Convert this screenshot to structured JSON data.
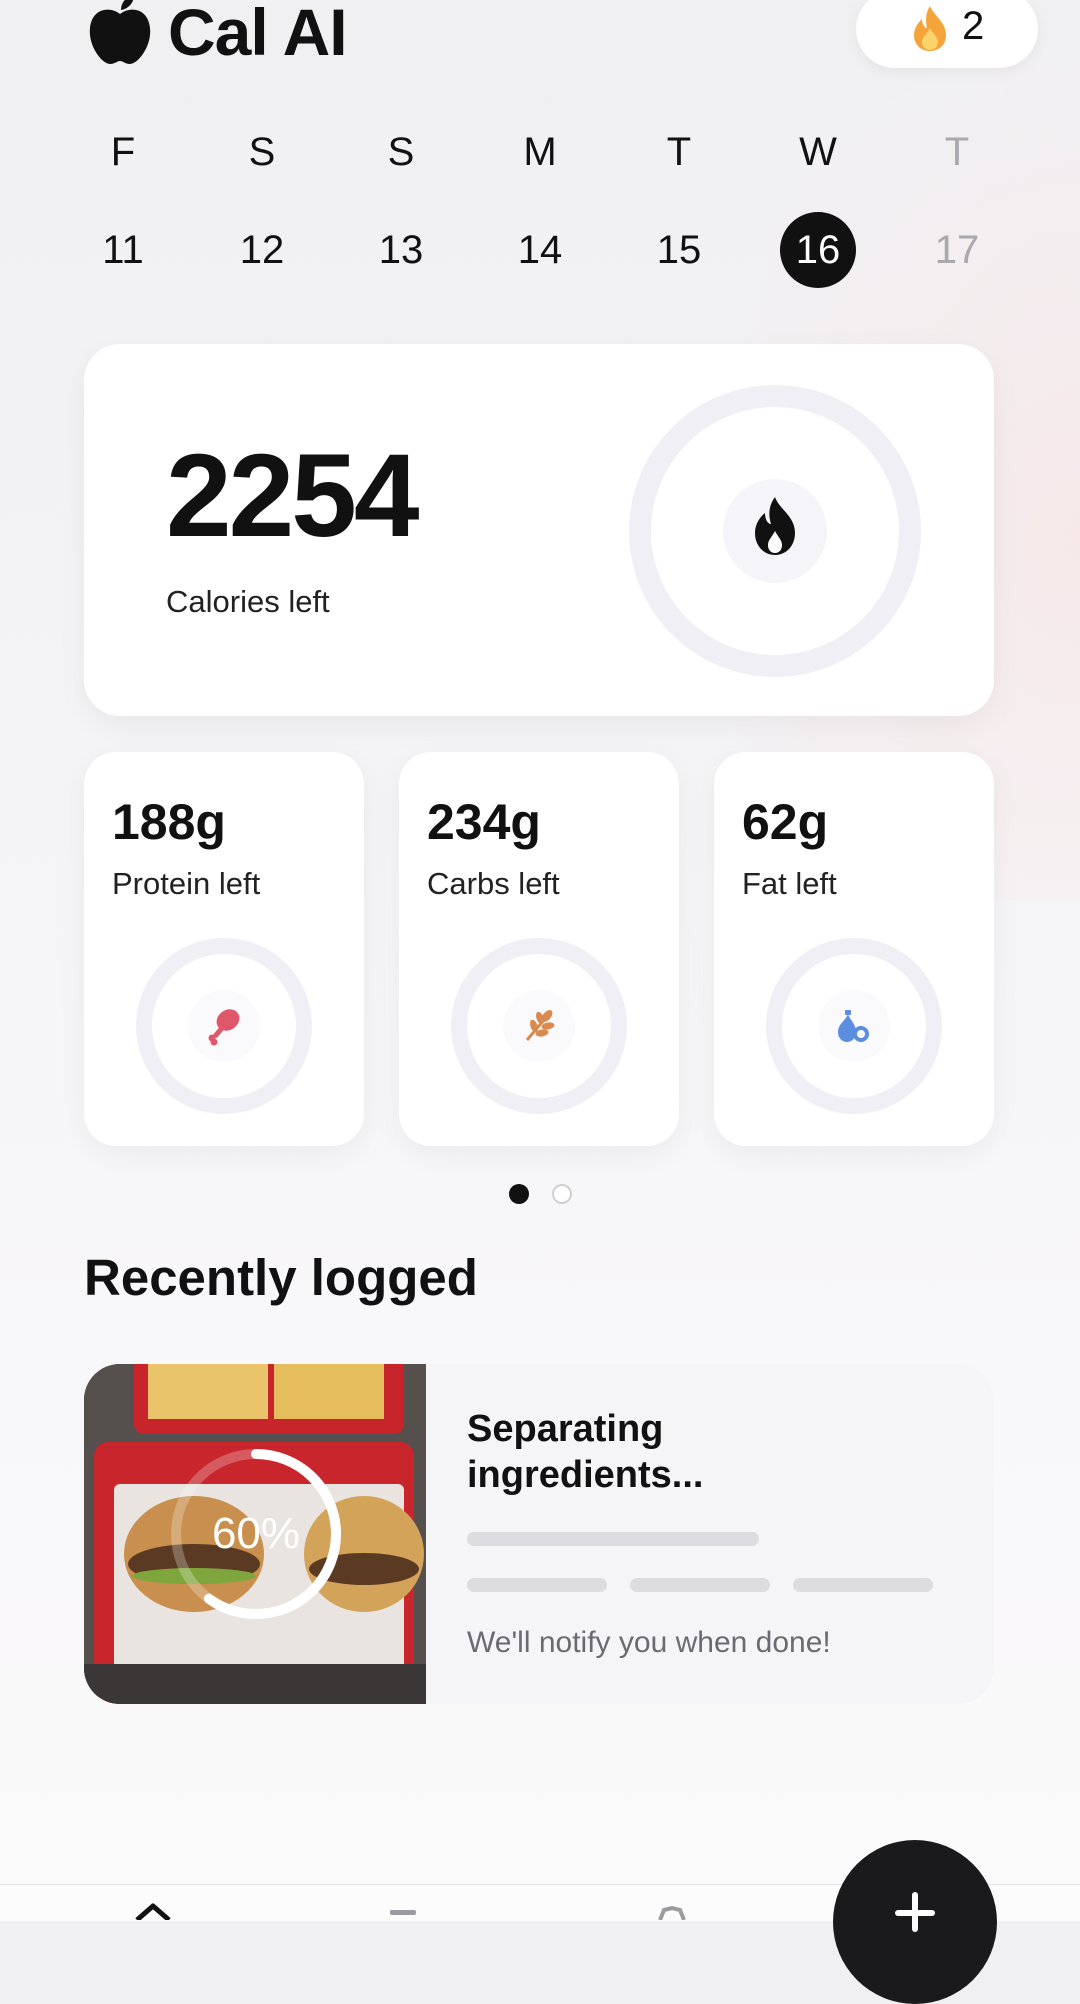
{
  "header": {
    "app_title": "Cal AI",
    "streak_count": "2",
    "logo_icon": "apple-icon",
    "streak_icon": "flame-icon"
  },
  "week": {
    "days": [
      {
        "letter": "F",
        "date": "11",
        "state": "normal"
      },
      {
        "letter": "S",
        "date": "12",
        "state": "normal"
      },
      {
        "letter": "S",
        "date": "13",
        "state": "normal"
      },
      {
        "letter": "M",
        "date": "14",
        "state": "normal"
      },
      {
        "letter": "T",
        "date": "15",
        "state": "normal"
      },
      {
        "letter": "W",
        "date": "16",
        "state": "selected"
      },
      {
        "letter": "T",
        "date": "17",
        "state": "future"
      }
    ]
  },
  "calories": {
    "value": "2254",
    "label": "Calories left",
    "icon": "flame-icon"
  },
  "macros": [
    {
      "value": "188g",
      "label": "Protein left",
      "icon": "drumstick-icon",
      "color": "#e0576b"
    },
    {
      "value": "234g",
      "label": "Carbs left",
      "icon": "wheat-icon",
      "color": "#d98a4e"
    },
    {
      "value": "62g",
      "label": "Fat left",
      "icon": "oil-drop-icon",
      "color": "#5b8ee0"
    }
  ],
  "pager": {
    "pages": 2,
    "active": 1
  },
  "recent": {
    "section_title": "Recently logged",
    "item": {
      "title": "Separating ingredients...",
      "progress_text": "60%",
      "progress": 0.6,
      "note": "We'll notify you when done!"
    }
  },
  "colors": {
    "accent": "#111111",
    "ring_track": "#efeff5",
    "protein": "#e0576b",
    "carbs": "#d98a4e",
    "fat": "#5b8ee0"
  },
  "nav": {
    "items": [
      "home-icon",
      "analytics-icon",
      "settings-icon"
    ],
    "fab_icon": "plus-icon"
  }
}
